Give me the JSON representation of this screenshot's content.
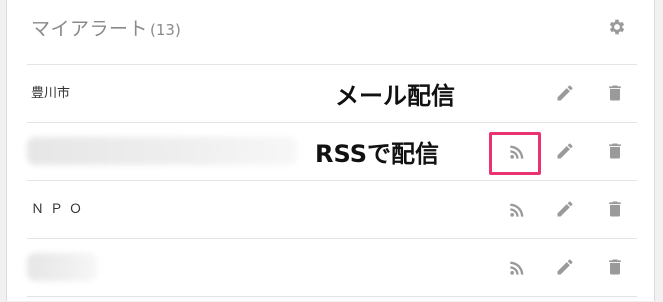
{
  "header": {
    "title": "マイアラート",
    "count": "(13)"
  },
  "alerts": [
    {
      "label": "豊川市",
      "rss_visible": false
    },
    {
      "label": "",
      "rss_visible": true
    },
    {
      "label": "ＮＰＯ",
      "rss_visible": true
    },
    {
      "label": "",
      "rss_visible": true
    }
  ],
  "annotations": {
    "email": "メール配信",
    "rss": "RSSで配信"
  },
  "colors": {
    "icon": "#9a9a9a",
    "highlight": "#e8336f",
    "title": "#8a8a8a"
  }
}
